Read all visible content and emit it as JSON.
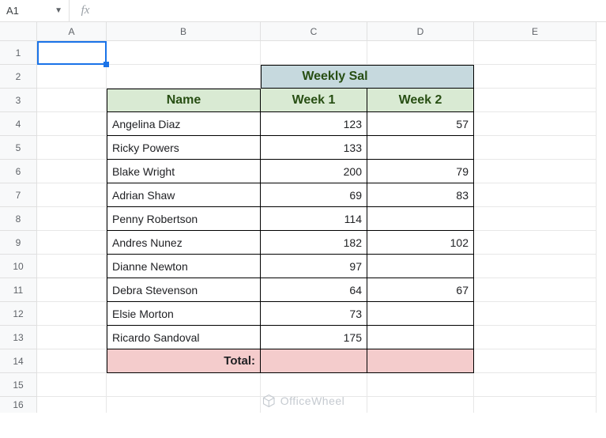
{
  "namebox": "A1",
  "fx": "fx",
  "formula_value": "",
  "cols": [
    "A",
    "B",
    "C",
    "D",
    "E"
  ],
  "rows": [
    "1",
    "2",
    "3",
    "4",
    "5",
    "6",
    "7",
    "8",
    "9",
    "10",
    "11",
    "12",
    "13",
    "14",
    "15",
    "16"
  ],
  "headers": {
    "weekly": "Weekly Sales Amount",
    "name": "Name",
    "w1": "Week 1",
    "w2": "Week 2"
  },
  "data": [
    {
      "name": "Angelina Diaz",
      "w1": "123",
      "w2": "57"
    },
    {
      "name": "Ricky Powers",
      "w1": "133",
      "w2": ""
    },
    {
      "name": "Blake Wright",
      "w1": "200",
      "w2": "79"
    },
    {
      "name": "Adrian Shaw",
      "w1": "69",
      "w2": "83"
    },
    {
      "name": "Penny Robertson",
      "w1": "114",
      "w2": ""
    },
    {
      "name": "Andres Nunez",
      "w1": "182",
      "w2": "102"
    },
    {
      "name": "Dianne Newton",
      "w1": "97",
      "w2": ""
    },
    {
      "name": "Debra Stevenson",
      "w1": "64",
      "w2": "67"
    },
    {
      "name": "Elsie Morton",
      "w1": "73",
      "w2": ""
    },
    {
      "name": "Ricardo Sandoval",
      "w1": "175",
      "w2": ""
    }
  ],
  "total_label": "Total:",
  "watermark": "OfficeWheel"
}
